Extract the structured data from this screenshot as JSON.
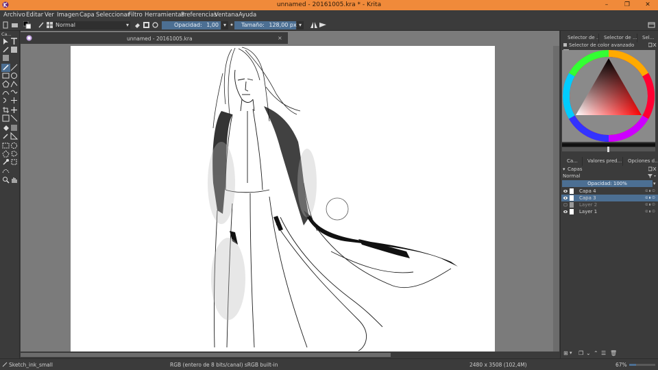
{
  "window": {
    "title": "unnamed - 20161005.kra * - Krita",
    "minimize": "–",
    "maximize": "❐",
    "close": "✕"
  },
  "menu": [
    "Archivo",
    "Editar",
    "Ver",
    "Imagen",
    "Capa",
    "Seleccionar",
    "Filtro",
    "Herramientas",
    "Preferencias",
    "Ventana",
    "Ayuda"
  ],
  "toolbar": {
    "blend_mode": "Normal",
    "opacity_label": "Opacidad:",
    "opacity_value": "1,00",
    "size_label": "Tamaño:",
    "size_value": "128,00 px"
  },
  "toolbox": {
    "header": "Ca..."
  },
  "document": {
    "tab_label": "unnamed - 20161005.kra",
    "tab_close": "×"
  },
  "dock": {
    "top_tabs": [
      "Selector de ...",
      "Selector de ...",
      "Sel..."
    ],
    "color_panel_title": "Selector de color avanzado",
    "mid_tabs": [
      "Ca...",
      "Valores pred...",
      "Opciones d..."
    ],
    "layers_title": "Capas",
    "layers_blend_mode": "Normal",
    "layers_opacity": "Opacidad:  100%",
    "layers": [
      {
        "name": "Capa 4",
        "selected": false,
        "visible": true
      },
      {
        "name": "Capa 3",
        "selected": true,
        "visible": true
      },
      {
        "name": "Layer 2",
        "selected": false,
        "visible": false
      },
      {
        "name": "Layer 1",
        "selected": false,
        "visible": true
      }
    ]
  },
  "status": {
    "brush_preset": "Sketch_ink_small",
    "color_space": "RGB (entero de 8 bits/canal)  sRGB built-in",
    "image_size": "2480 x 3508 (102,4M)",
    "zoom": "67%"
  },
  "colors": {
    "titlebar": "#f08a3a",
    "panel_bg": "#3b3b3b",
    "selection": "#4c6f93",
    "canvas_bg": "#7b7b7b"
  }
}
